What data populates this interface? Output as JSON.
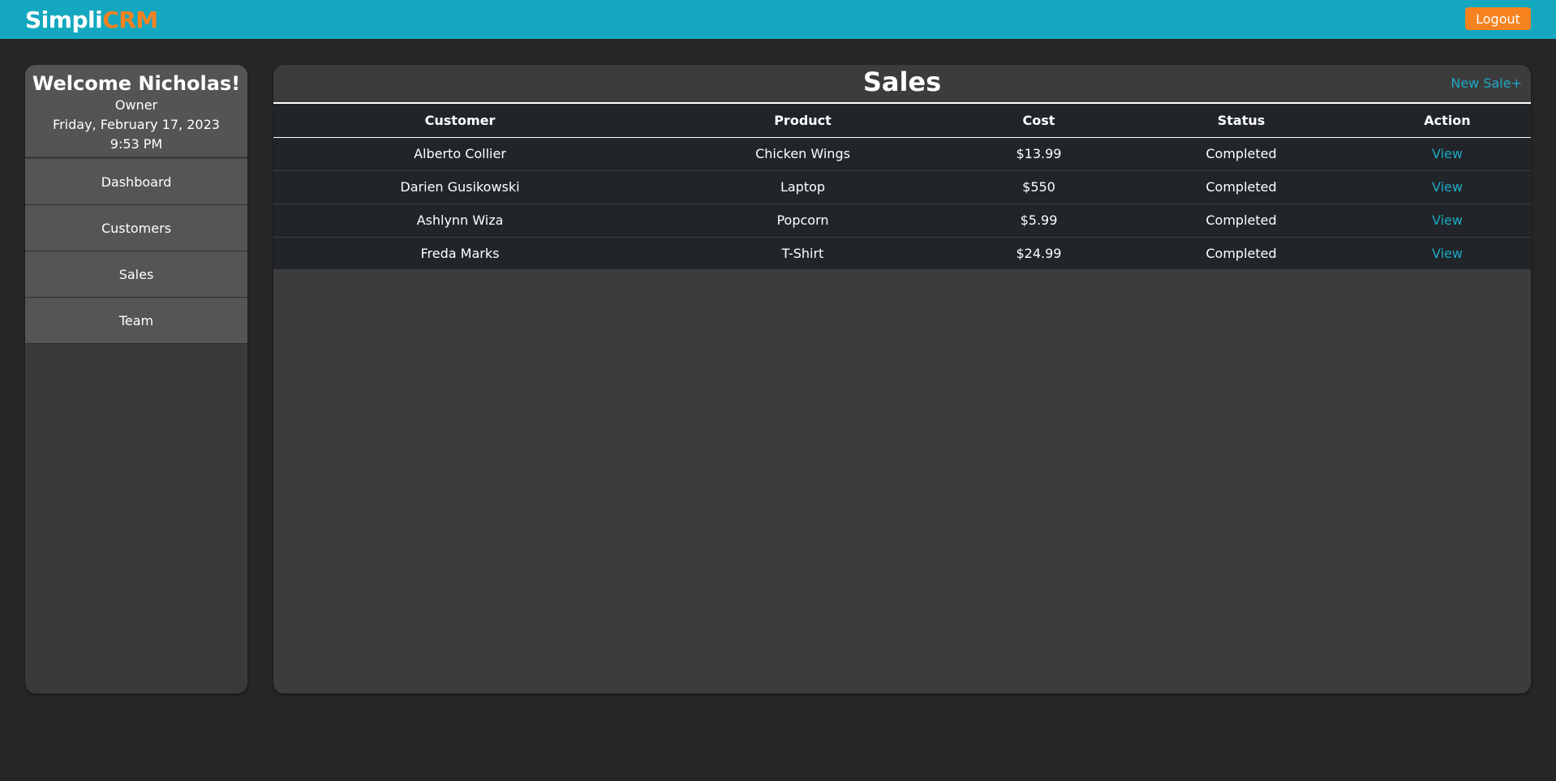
{
  "brand": {
    "part1": "Simpli",
    "part2": "CRM"
  },
  "header": {
    "logout_label": "Logout"
  },
  "sidebar": {
    "welcome": "Welcome Nicholas!",
    "role": "Owner",
    "date": "Friday, February 17, 2023",
    "time": "9:53 PM",
    "items": [
      {
        "label": "Dashboard"
      },
      {
        "label": "Customers"
      },
      {
        "label": "Sales"
      },
      {
        "label": "Team"
      }
    ]
  },
  "main": {
    "title": "Sales",
    "new_sale_label": "New Sale+",
    "columns": [
      "Customer",
      "Product",
      "Cost",
      "Status",
      "Action"
    ],
    "rows": [
      {
        "customer": "Alberto Collier",
        "product": "Chicken Wings",
        "cost": "$13.99",
        "status": "Completed",
        "action": "View"
      },
      {
        "customer": "Darien Gusikowski",
        "product": "Laptop",
        "cost": "$550",
        "status": "Completed",
        "action": "View"
      },
      {
        "customer": "Ashlynn Wiza",
        "product": "Popcorn",
        "cost": "$5.99",
        "status": "Completed",
        "action": "View"
      },
      {
        "customer": "Freda Marks",
        "product": "T-Shirt",
        "cost": "$24.99",
        "status": "Completed",
        "action": "View"
      }
    ]
  },
  "colors": {
    "topbar": "#14a8c0",
    "accent_orange": "#f5821f",
    "link": "#1ca9c4",
    "background": "#262626"
  }
}
